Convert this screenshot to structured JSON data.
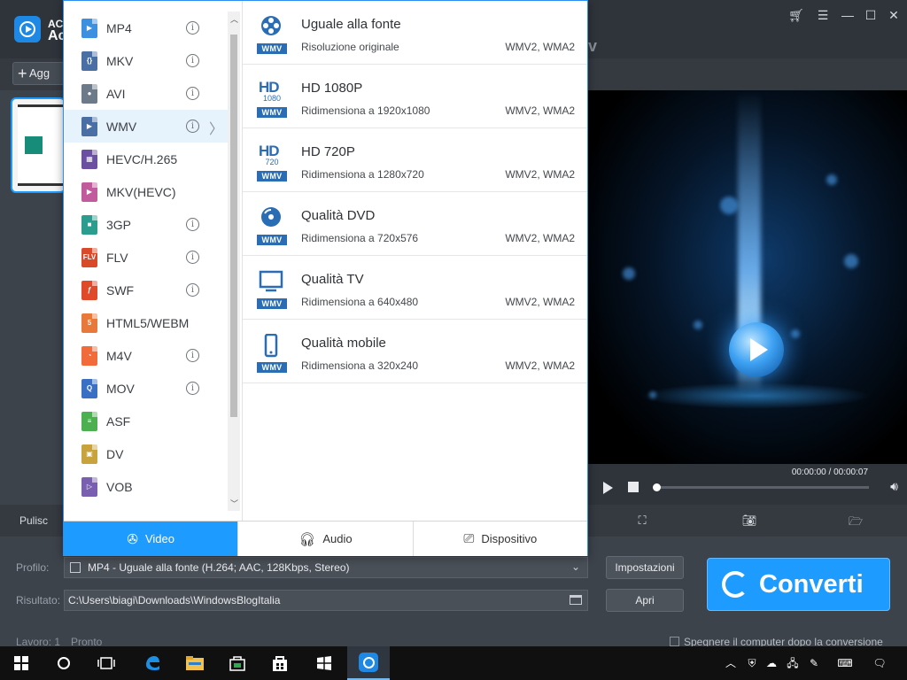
{
  "app": {
    "short_name": "AC",
    "name_prefix": "Ac",
    "title_tail": "v"
  },
  "toolbar": {
    "add_label": "Agg"
  },
  "format_list": [
    {
      "label": "MP4",
      "color": "#3d8fe0",
      "glyph": "▶",
      "info": true
    },
    {
      "label": "MKV",
      "color": "#4a6fa5",
      "glyph": "{}",
      "info": true
    },
    {
      "label": "AVI",
      "color": "#6c7a89",
      "glyph": "●",
      "info": true
    },
    {
      "label": "WMV",
      "color": "#4a6fa5",
      "glyph": "▶",
      "info": true,
      "active": true
    },
    {
      "label": "HEVC/H.265",
      "color": "#6b4fa0",
      "glyph": "▦",
      "info": false
    },
    {
      "label": "MKV(HEVC)",
      "color": "#c25b9e",
      "glyph": "▶",
      "info": false
    },
    {
      "label": "3GP",
      "color": "#2a9d8f",
      "glyph": "■",
      "info": true
    },
    {
      "label": "FLV",
      "color": "#d94a2b",
      "glyph": "FLV",
      "info": true
    },
    {
      "label": "SWF",
      "color": "#e04a2a",
      "glyph": "ƒ",
      "info": true
    },
    {
      "label": "HTML5/WEBM",
      "color": "#e8793a",
      "glyph": "5",
      "info": false
    },
    {
      "label": "M4V",
      "color": "#f26b3a",
      "glyph": "◔",
      "info": true
    },
    {
      "label": "MOV",
      "color": "#3a6fc4",
      "glyph": "Q",
      "info": true
    },
    {
      "label": "ASF",
      "color": "#4caf50",
      "glyph": "≡",
      "info": false
    },
    {
      "label": "DV",
      "color": "#c8a23c",
      "glyph": "▣",
      "info": false
    },
    {
      "label": "VOB",
      "color": "#7a5fb0",
      "glyph": "▷",
      "info": false
    }
  ],
  "options": [
    {
      "title": "Uguale alla fonte",
      "subtitle": "Risoluzione originale",
      "codec": "WMV2, WMA2",
      "badge": "source",
      "tag": "WMV"
    },
    {
      "title": "HD 1080P",
      "subtitle": "Ridimensiona a 1920x1080",
      "codec": "WMV2, WMA2",
      "badge": "hd1080",
      "tag": "WMV",
      "badge_top": "HD",
      "badge_num": "1080"
    },
    {
      "title": "HD 720P",
      "subtitle": "Ridimensiona a 1280x720",
      "codec": "WMV2, WMA2",
      "badge": "hd720",
      "tag": "WMV",
      "badge_top": "HD",
      "badge_num": "720"
    },
    {
      "title": "Qualità DVD",
      "subtitle": "Ridimensiona a 720x576",
      "codec": "WMV2, WMA2",
      "badge": "dvd",
      "tag": "WMV"
    },
    {
      "title": "Qualità TV",
      "subtitle": "Ridimensiona a 640x480",
      "codec": "WMV2, WMA2",
      "badge": "tv",
      "tag": "WMV"
    },
    {
      "title": "Qualità mobile",
      "subtitle": "Ridimensiona a 320x240",
      "codec": "WMV2, WMA2",
      "badge": "mobile",
      "tag": "WMV"
    }
  ],
  "tabs": [
    {
      "label": "Video",
      "icon": "film-reel-icon",
      "active": true
    },
    {
      "label": "Audio",
      "icon": "headphones-icon",
      "active": false
    },
    {
      "label": "Dispositivo",
      "icon": "devices-icon",
      "active": false
    }
  ],
  "player": {
    "time": "00:00:00 / 00:00:07"
  },
  "tools": {
    "clean_label": "Pulisc"
  },
  "output": {
    "profile_label": "Profilo:",
    "profile_value": "MP4 - Uguale alla fonte (H.264; AAC, 128Kbps, Stereo)",
    "result_label": "Risultato:",
    "result_path": "C:\\Users\\biagi\\Downloads\\WindowsBlogItalia",
    "settings_button": "Impostazioni",
    "open_button": "Apri",
    "convert_button": "Converti",
    "tasks_label": "Lavoro: 1",
    "status_label": "Pronto",
    "shutdown_label": "Spegnere il computer dopo la conversione"
  },
  "colors": {
    "accent": "#1e9bff",
    "wmv_tag": "#2b6db5"
  }
}
